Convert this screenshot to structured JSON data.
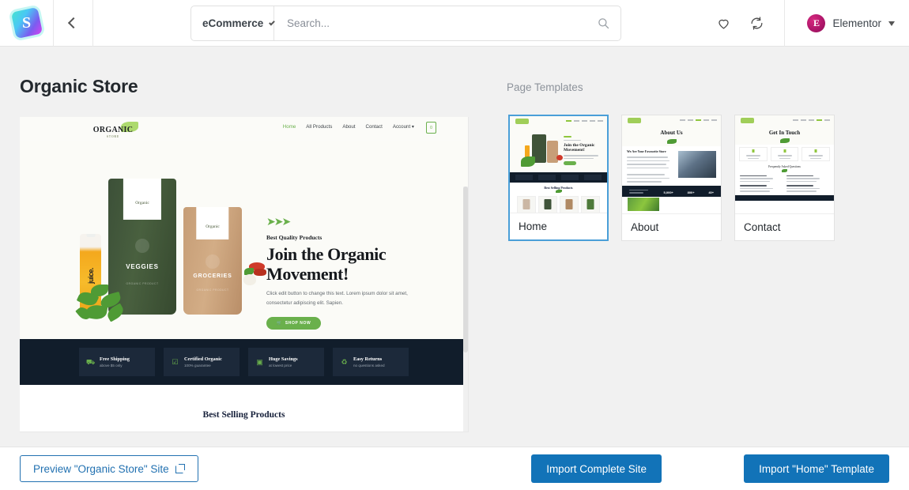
{
  "header": {
    "logo_icon": "s-logo-icon",
    "back_icon": "chevron-left-icon",
    "category": "eCommerce",
    "category_caret": "chevron-down-icon",
    "search_placeholder": "Search...",
    "search_value": "",
    "search_icon": "search-icon",
    "favorites_icon": "heart-icon",
    "sync_icon": "sync-icon",
    "avatar_letter": "E",
    "user_name": "Elementor",
    "user_caret": "caret-down-icon"
  },
  "main": {
    "page_title": "Organic Store",
    "templates_label": "Page Templates"
  },
  "preview": {
    "site_logo": "ORGANIC",
    "site_logo_sub": "STORE",
    "nav": [
      {
        "label": "Home",
        "active": true
      },
      {
        "label": "All Products",
        "active": false
      },
      {
        "label": "About",
        "active": false
      },
      {
        "label": "Contact",
        "active": false
      },
      {
        "label": "Account",
        "active": false
      }
    ],
    "cart_icon": "cart-icon",
    "hero": {
      "arrows": "➤➤➤",
      "kicker": "Best Quality Products",
      "title_line1": "Join the Organic",
      "title_line2": "Movement!",
      "description": "Click edit button to change this text. Lorem ipsum dolor sit amet, consectetur adipiscing elit. Sapien.",
      "cta": "SHOP NOW",
      "cta_icon": "cart-icon"
    },
    "products": [
      {
        "name": "VEGGIES",
        "tag": "Organic",
        "sub": "ORGANIC PRODUCT"
      },
      {
        "name": "GROCERIES",
        "tag": "Organic",
        "sub": "ORGANIC PRODUCT"
      }
    ],
    "bottle_label": "juice.",
    "features": [
      {
        "icon": "truck-icon",
        "glyph": "⛟",
        "title": "Free Shipping",
        "subtitle": "above $5 only"
      },
      {
        "icon": "certificate-icon",
        "glyph": "☑",
        "title": "Certified Organic",
        "subtitle": "100% guarantee"
      },
      {
        "icon": "money-icon",
        "glyph": "▣",
        "title": "Huge Savings",
        "subtitle": "at lowest price"
      },
      {
        "icon": "recycle-icon",
        "glyph": "♻",
        "title": "Easy Returns",
        "subtitle": "no questions asked"
      }
    ],
    "best_selling": "Best Selling Products",
    "scrollbar": "vertical-scrollbar"
  },
  "templates": [
    {
      "label": "Home",
      "selected": true,
      "heading": "Join the Organic Movement!",
      "section": "Best Selling Products"
    },
    {
      "label": "About",
      "selected": false,
      "heading": "About Us",
      "sub": "We Are Your Favourite Store",
      "stats": [
        "5,000+",
        "800+",
        "40+"
      ]
    },
    {
      "label": "Contact",
      "selected": false,
      "heading": "Get In Touch",
      "sub": "Frequently Asked Questions"
    }
  ],
  "footer": {
    "preview_label": "Preview \"Organic Store\" Site",
    "preview_icon": "external-link-icon",
    "import_site_label": "Import Complete Site",
    "import_template_label": "Import \"Home\" Template",
    "annotation_arrow": "red-pointer-arrow"
  },
  "colors": {
    "primary_blue": "#1273b8",
    "link_blue": "#2271b1",
    "selected_border": "#4a9fd8",
    "organic_green": "#6ab04c",
    "dark_navy": "#111d2b",
    "annotation_red": "#e8110f",
    "page_bg": "#f1f1f1"
  }
}
